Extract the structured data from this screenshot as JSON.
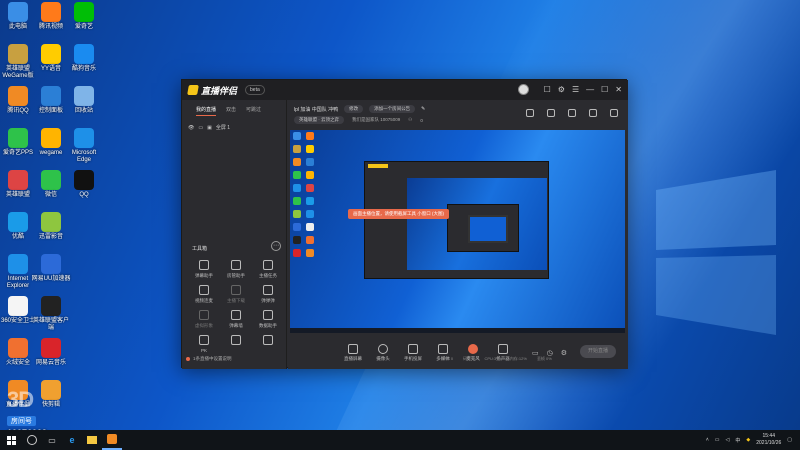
{
  "desktop": {
    "icons": [
      {
        "label": "此电脑",
        "color": "#3a8ee6"
      },
      {
        "label": "腾讯视频",
        "color": "#ff7a1a"
      },
      {
        "label": "爱奇艺",
        "color": "#00be06"
      },
      {
        "label": "英雄联盟 WeGame版",
        "color": "#c8a040"
      },
      {
        "label": "YY语音",
        "color": "#ffcc00"
      },
      {
        "label": "酷狗音乐",
        "color": "#1a8bf0"
      },
      {
        "label": "腾讯QQ",
        "color": "#f08a24"
      },
      {
        "label": "控制面板",
        "color": "#2b7fd6"
      },
      {
        "label": "回收站",
        "color": "#7fb4e8"
      },
      {
        "label": "爱奇艺PPS",
        "color": "#2ec24a"
      },
      {
        "label": "wegame",
        "color": "#ffb400"
      },
      {
        "label": "Microsoft Edge",
        "color": "#1e90e8"
      },
      {
        "label": "英雄联盟",
        "color": "#d44"
      },
      {
        "label": "微信",
        "color": "#2ec24a"
      },
      {
        "label": "QQ",
        "color": "#111"
      },
      {
        "label": "优酷",
        "color": "#1a9be8"
      },
      {
        "label": "迅雷影音",
        "color": "#8ec63f"
      },
      {
        "label": "Internet Explorer",
        "color": "#1e90e8"
      },
      {
        "label": "网易UU加速器",
        "color": "#2c6ad8"
      },
      {
        "label": "360安全卫士",
        "color": "#f5f5f5"
      },
      {
        "label": "英雄联盟客户端",
        "color": "#222"
      },
      {
        "label": "火绒安全",
        "color": "#f07030"
      },
      {
        "label": "网易云音乐",
        "color": "#d9242a"
      },
      {
        "label": "直播伴侣",
        "color": "#f08a24"
      },
      {
        "label": "快剪辑",
        "color": "#f0a030"
      }
    ]
  },
  "app": {
    "logo_text": "直播伴侣",
    "version_badge": "beta",
    "title_controls": [
      "☺",
      "☐",
      "⚙",
      "☰",
      "—",
      "☐",
      "✕"
    ],
    "left_tabs": [
      "我的直播",
      "双击",
      "可跳过"
    ],
    "scene_label": "全屏 1",
    "toolbox_title": "工具箱",
    "tools": [
      {
        "label": "弹幕助手"
      },
      {
        "label": "房管助手"
      },
      {
        "label": "主播任务"
      },
      {
        "label": "视频连麦"
      },
      {
        "label": "主播下载"
      },
      {
        "label": "弹弹弹"
      },
      {
        "label": "虚拟形象"
      },
      {
        "label": "弹幕墙"
      },
      {
        "label": "数据助手"
      },
      {
        "label": "PK"
      },
      {
        "label": ""
      },
      {
        "label": ""
      }
    ],
    "left_footer": "1条直播中设置说明",
    "room": {
      "name": "lpl 加油 中国队 冲鸭",
      "edit_btn": "修改",
      "notice_btn": "添加一个房间公告",
      "category": "英雄联盟 · 云顶之弈",
      "host": "我们是国家队 10075009",
      "viewers": "0"
    },
    "preview": {
      "tooltip": "画面主播位置，请使用截屏工具 小窗口 (大图)"
    },
    "bottom_tools": [
      {
        "label": "直播屏幕"
      },
      {
        "label": "摄像头"
      },
      {
        "label": "手机投屏"
      },
      {
        "label": "多媒体"
      },
      {
        "label": "麦克风"
      },
      {
        "label": "扬声器"
      }
    ],
    "start_btn": "开始直播",
    "stats": [
      "FPS 0",
      "码率:0",
      "CPU:3%",
      "内存:12%",
      "丢帧 0%"
    ]
  },
  "watermark": {
    "big": "3D",
    "tag": "房间号",
    "number": "10076009"
  },
  "taskbar": {
    "time": "15:44",
    "date": "2021/10/26",
    "lang": "中"
  }
}
